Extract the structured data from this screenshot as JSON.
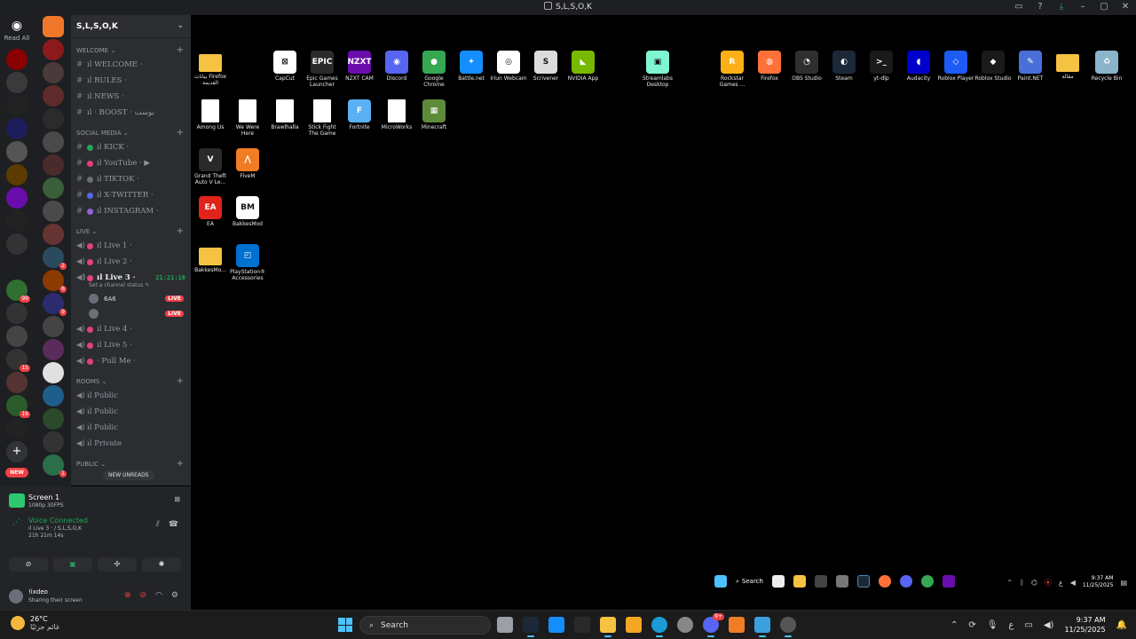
{
  "window": {
    "title": "S,L,S,O,K",
    "controls": [
      "inbox-icon",
      "help-icon",
      "download-icon",
      "minimize-icon",
      "maximize-icon",
      "close-icon"
    ]
  },
  "rail": {
    "home_label": "Read All",
    "new_label": "NEW",
    "add_label": "+",
    "left_badges": [
      "99",
      "15",
      "16",
      "27",
      "22"
    ],
    "right_badges": [
      "2",
      "6",
      "9",
      "1"
    ]
  },
  "guild": {
    "name": "S,L,S,O,K",
    "categories": [
      {
        "name": "WELCOME",
        "channels": [
          {
            "name": "ıl WELCOME ·",
            "type": "text"
          },
          {
            "name": "ıl RULES ·",
            "type": "text"
          },
          {
            "name": "ıl NEWS ·",
            "type": "text"
          },
          {
            "name": "ıl · BOOST · بوست",
            "type": "text"
          }
        ]
      },
      {
        "name": "Social Media",
        "channels": [
          {
            "name": "ıl KICK ·",
            "type": "text"
          },
          {
            "name": "ıl YouTube · ▶",
            "type": "text"
          },
          {
            "name": "ıl TIKTOK ·",
            "type": "text"
          },
          {
            "name": "ıl X-TWITTER ·",
            "type": "text"
          },
          {
            "name": "ıl INSTAGRAM ·",
            "type": "text"
          }
        ]
      },
      {
        "name": "Live",
        "channels": [
          {
            "name": "ıl Live 1 ·",
            "type": "voice"
          },
          {
            "name": "ıl Live 2 ·",
            "type": "voice"
          },
          {
            "name": "ıl Live 3 ·",
            "type": "voice",
            "active": true,
            "timer": "21:21:16",
            "status": "Set a channel status"
          },
          {
            "name": "ıl Live 4 ·",
            "type": "voice"
          },
          {
            "name": "ıl Live 5 ·",
            "type": "voice"
          },
          {
            "name": "· Pull Me ·",
            "type": "voice"
          }
        ]
      },
      {
        "name": "ROOMS",
        "channels": [
          {
            "name": "ıl Public",
            "type": "voice"
          },
          {
            "name": "ıl Public",
            "type": "voice"
          },
          {
            "name": "ıl Public",
            "type": "voice"
          },
          {
            "name": "ıl Private",
            "type": "voice"
          }
        ]
      },
      {
        "name": "PUBLIC",
        "channels": []
      }
    ],
    "voice_users": [
      {
        "name": "6A6",
        "badge": "LIVE"
      },
      {
        "name": "",
        "badge": "LIVE"
      }
    ],
    "new_unreads": "NEW UNREADS"
  },
  "screenshare": {
    "title": "Screen 1",
    "quality": "1080p 30FPS"
  },
  "voice": {
    "status": "Voice Connected",
    "channel": "ıl Live 3 · / S,L,S,O,K",
    "duration": "21h 21m 14s"
  },
  "user": {
    "name": "!ixdeo",
    "status": "Sharing their screen"
  },
  "desktop_icons": [
    {
      "label": "بيانات Firefox القديمة",
      "kind": "folder",
      "color": "#f5c242"
    },
    {
      "label": "CapCut",
      "kind": "app",
      "color": "#ffffff",
      "text": "⊠"
    },
    {
      "label": "Epic Games Launcher",
      "kind": "app",
      "color": "#2a2a2a",
      "text": "EPIC"
    },
    {
      "label": "NZXT CAM",
      "kind": "app",
      "color": "#6a0dad",
      "text": "NZXT"
    },
    {
      "label": "Discord",
      "kind": "app",
      "color": "#5865f2",
      "text": "◉"
    },
    {
      "label": "Google Chrome",
      "kind": "app",
      "color": "#34a853",
      "text": "●"
    },
    {
      "label": "Battle.net",
      "kind": "app",
      "color": "#148eff",
      "text": "✦"
    },
    {
      "label": "Iriun Webcam",
      "kind": "app",
      "color": "#ffffff",
      "text": "◎"
    },
    {
      "label": "Scrivener",
      "kind": "app",
      "color": "#dcdcdc",
      "text": "S"
    },
    {
      "label": "NVIDIA App",
      "kind": "app",
      "color": "#76b900",
      "text": "◣"
    },
    {
      "label": "Streamlabs Desktop",
      "kind": "app",
      "color": "#80f5d2",
      "text": "▣"
    },
    {
      "label": "Rockstar Games ...",
      "kind": "app",
      "color": "#fcaf17",
      "text": "R"
    },
    {
      "label": "Firefox",
      "kind": "app",
      "color": "#ff7139",
      "text": "◍"
    },
    {
      "label": "OBS Studio",
      "kind": "app",
      "color": "#302e31",
      "text": "◔"
    },
    {
      "label": "Steam",
      "kind": "app",
      "color": "#1b2838",
      "text": "◐"
    },
    {
      "label": "yt-dlp",
      "kind": "app",
      "color": "#1a1a1a",
      "text": ">_"
    },
    {
      "label": "Audacity",
      "kind": "app",
      "color": "#0000cc",
      "text": "◖"
    },
    {
      "label": "Roblox Player",
      "kind": "app",
      "color": "#1e5bf5",
      "text": "◇"
    },
    {
      "label": "Roblox Studio",
      "kind": "app",
      "color": "#1a1a1a",
      "text": "◆"
    },
    {
      "label": "Paint.NET",
      "kind": "app",
      "color": "#4a6fd8",
      "text": "✎"
    },
    {
      "label": "مقالة",
      "kind": "folder",
      "color": "#f5c242"
    },
    {
      "label": "Recycle Bin",
      "kind": "app",
      "color": "#8ab4c9",
      "text": "♻"
    },
    {
      "label": "Among Us",
      "kind": "doc",
      "color": "#ffffff"
    },
    {
      "label": "We Were Here",
      "kind": "doc",
      "color": "#ffffff"
    },
    {
      "label": "Brawlhalla",
      "kind": "doc",
      "color": "#ffffff"
    },
    {
      "label": "Stick Fight The Game",
      "kind": "doc",
      "color": "#ffffff"
    },
    {
      "label": "Fortnite",
      "kind": "app",
      "color": "#5ab0f5",
      "text": "F"
    },
    {
      "label": "MicroWorks",
      "kind": "doc",
      "color": "#ffffff"
    },
    {
      "label": "Minecraft",
      "kind": "app",
      "color": "#5d8b3a",
      "text": "▦"
    },
    {
      "label": "Grand Theft Auto V Le...",
      "kind": "app",
      "color": "#2a2a2a",
      "text": "V"
    },
    {
      "label": "FiveM",
      "kind": "app",
      "color": "#f07c24",
      "text": "⋀"
    },
    {
      "label": "EA",
      "kind": "app",
      "color": "#e2231a",
      "text": "EA"
    },
    {
      "label": "BakkesMod",
      "kind": "app",
      "color": "#ffffff",
      "text": "BM"
    },
    {
      "label": "BakkesMo...",
      "kind": "folder",
      "color": "#f5c242"
    },
    {
      "label": "PlayStation® Accessories",
      "kind": "app",
      "color": "#0070d1",
      "text": "◰"
    }
  ],
  "inner_taskbar": {
    "search_label": "Search",
    "time": "9:37 AM",
    "date": "11/25/2025",
    "lang": "ع"
  },
  "taskbar": {
    "weather_temp": "26°C",
    "weather_cond": "غائم جزئيًا",
    "search_label": "Search",
    "time": "9:37 AM",
    "date": "11/25/2025",
    "lang": "ع",
    "discord_badge": "9+",
    "apps": [
      {
        "name": "task-view-icon",
        "color": "#9aa0a6"
      },
      {
        "name": "steam-icon",
        "color": "#1b2838"
      },
      {
        "name": "battlenet-icon",
        "color": "#148eff"
      },
      {
        "name": "epic-games-icon",
        "color": "#2a2a2a"
      },
      {
        "name": "file-explorer-icon",
        "color": "#f5c242"
      },
      {
        "name": "fivem-icon",
        "color": "#f5a623"
      },
      {
        "name": "edge-icon",
        "color": "#1a9bd7"
      },
      {
        "name": "settings-icon",
        "color": "#888888"
      },
      {
        "name": "discord-icon",
        "color": "#5865f2"
      },
      {
        "name": "fivem-orange-icon",
        "color": "#f07c24"
      },
      {
        "name": "notepad-icon",
        "color": "#3ba0e0"
      },
      {
        "name": "obs-icon",
        "color": "#555555"
      }
    ]
  },
  "colors": {
    "accent_green": "#23a559",
    "live_red": "#f23f43",
    "blurple": "#5865f2"
  }
}
